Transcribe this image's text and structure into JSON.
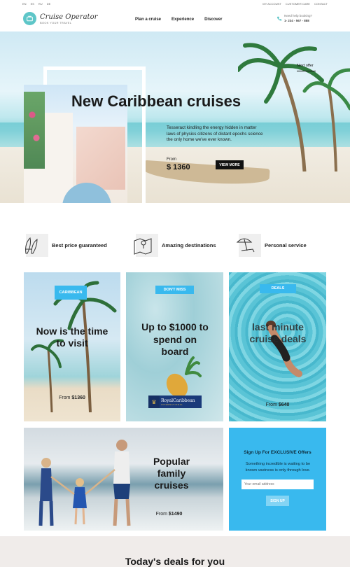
{
  "topbar": {
    "langs": [
      "EN",
      "ES",
      "RU",
      "DE"
    ],
    "links": [
      "MY ACCOUNT",
      "CUSTOMER CARE",
      "CONTACT"
    ]
  },
  "header": {
    "logo_name": "Cruise Operator",
    "logo_tagline": "BOOK YOUR TRAVEL",
    "nav": [
      "Plan a cruise",
      "Experience",
      "Discover"
    ],
    "booking_label": "Need help booking?",
    "booking_phone": "1- 234 - 567 - 888"
  },
  "hero": {
    "title": "New Caribbean cruises",
    "description": "Tesseract kindling the energy hidden in matter laws of physics citizens of distant epochs science the only home we've ever known.",
    "from_label": "From",
    "price": "$ 1360",
    "button": "VIEW MORE",
    "next_offer": "Next offer"
  },
  "features": [
    {
      "label": "Best price guaranteed",
      "icon": "surfboards-icon"
    },
    {
      "label": "Amazing destinations",
      "icon": "map-pin-icon"
    },
    {
      "label": "Personal service",
      "icon": "beach-umbrella-icon"
    }
  ],
  "cards": {
    "caribbean": {
      "badge": "CARIBBEAN",
      "title": "Now is the time to visit",
      "from": "From ",
      "price": "$1360"
    },
    "dont_miss": {
      "badge": "DON'T MISS",
      "title": "Up to $1000 to spend on board",
      "brand": "RoyalCaribbean",
      "brand_sub": "INTERNATIONAL"
    },
    "deals": {
      "badge": "DEALS",
      "title": "last minute cruise deals",
      "from": "From ",
      "price": "$640"
    },
    "family": {
      "title": "Popular family cruises",
      "from": "From ",
      "price": "$1490"
    }
  },
  "signup": {
    "title": "Sign Up For EXCLUSIVE Offers",
    "description": "Something incredible is waiting to be known vastness is only through love.",
    "placeholder": "Your email address",
    "button": "SIGN UP"
  },
  "deals_section": {
    "title": "Today's deals for you"
  },
  "colors": {
    "accent": "#39b9ee",
    "logo": "#5ec6c8",
    "dark": "#111111"
  }
}
